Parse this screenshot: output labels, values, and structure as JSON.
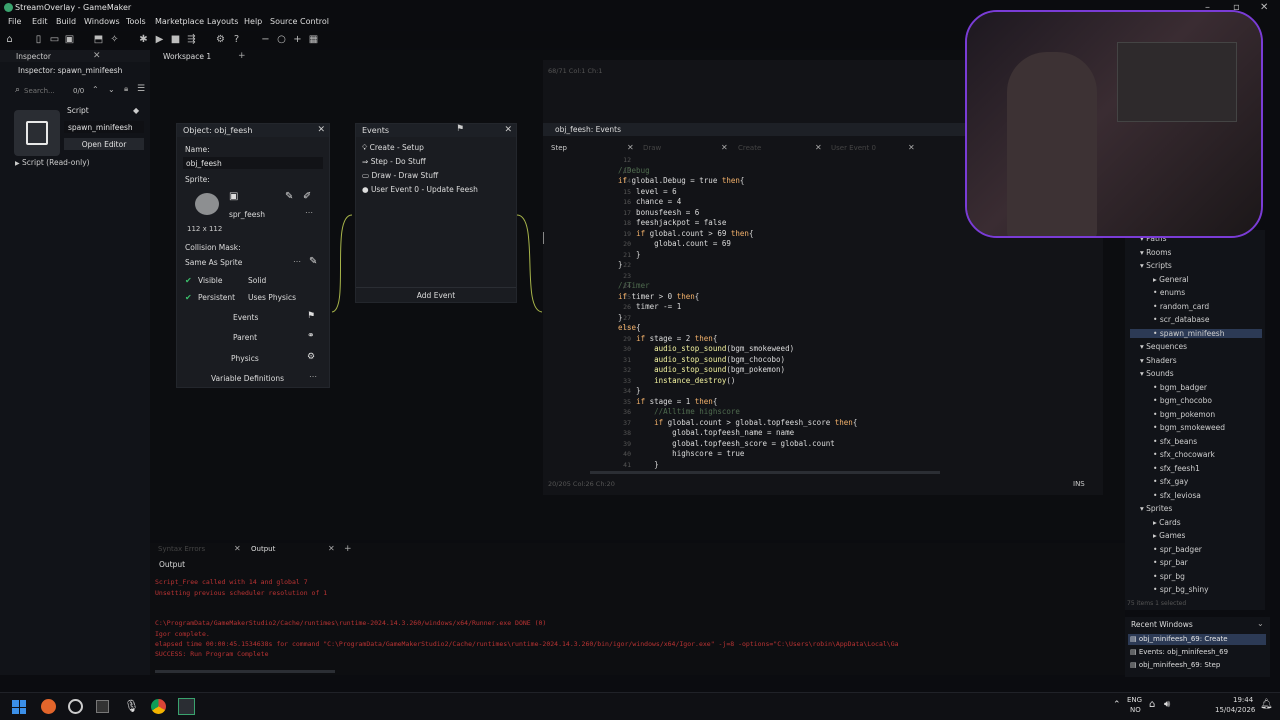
{
  "window": {
    "title": "StreamOverlay - GameMaker"
  },
  "menu": [
    "File",
    "Edit",
    "Build",
    "Windows",
    "Tools",
    "Marketplace",
    "Layouts",
    "Help",
    "Source Control"
  ],
  "inspector": {
    "tab": "Inspector",
    "subtitle": "Inspector: spawn_minifeesh",
    "search_placeholder": "Search...",
    "count": "0/0",
    "script_label": "Script",
    "script_name": "spawn_minifeesh",
    "open_editor": "Open Editor",
    "tree_item": "Script (Read-only)"
  },
  "workspace_tab": "Workspace 1",
  "object_panel": {
    "title": "Object: obj_feesh",
    "name_label": "Name:",
    "name_value": "obj_feesh",
    "sprite_label": "Sprite:",
    "sprite_name": "spr_feesh",
    "sprite_size": "112 x 112",
    "collision_label": "Collision Mask:",
    "collision_value": "Same As Sprite",
    "visible": "Visible",
    "solid": "Solid",
    "persistent": "Persistent",
    "uses_physics": "Uses Physics",
    "events_btn": "Events",
    "parent_btn": "Parent",
    "physics_btn": "Physics",
    "variable_defs": "Variable Definitions"
  },
  "events_panel": {
    "title": "Events",
    "items": [
      "Create - Setup",
      "Step - Do Stuff",
      "Draw - Draw Stuff",
      "User Event 0 - Update Feesh"
    ],
    "add_event": "Add Event"
  },
  "code_panel": {
    "title": "obj_feesh: Events",
    "tabs": [
      "Step",
      "Draw",
      "Create",
      "User Event 0"
    ],
    "top_status": "68/71 Col:1 Ch:1",
    "bottom_status": "20/205 Col:26 Ch:20",
    "mode": "INS",
    "line_numbers": [
      "12",
      "13",
      "14",
      "15",
      "16",
      "17",
      "18",
      "19",
      "20",
      "21",
      "22",
      "23",
      "24",
      "25",
      "26",
      "27",
      "28",
      "29",
      "30",
      "31",
      "32",
      "33",
      "34",
      "35",
      "36",
      "37",
      "38",
      "39",
      "40",
      "41"
    ],
    "lines": [
      "",
      "//Debug",
      "if global.Debug = true then{",
      "    level = 6",
      "    chance = 4",
      "    bonusfeesh = 6",
      "    feeshjackpot = false",
      "    if global.count > 69 then{",
      "        global.count = 69",
      "    }",
      "}",
      "",
      "//Timer",
      "if timer > 0 then{",
      "    timer -= 1",
      "}",
      "else{",
      "    if stage = 2 then{",
      "        audio_stop_sound(bgm_smokeweed)",
      "        audio_stop_sound(bgm_chocobo)",
      "        audio_stop_sound(bgm_pokemon)",
      "        instance_destroy()",
      "    }",
      "    if stage = 1 then{",
      "        //Alltime highscore",
      "        if global.count > global.topfeesh_score then{",
      "            global.topfeesh_name = name",
      "            global.topfeesh_score = global.count",
      "            highscore = true",
      "        }"
    ]
  },
  "assets": {
    "items": [
      {
        "label": "Paths",
        "indent": 1
      },
      {
        "label": "Rooms",
        "indent": 1
      },
      {
        "label": "Scripts",
        "indent": 1
      },
      {
        "label": "General",
        "indent": 2
      },
      {
        "label": "enums",
        "indent": 2
      },
      {
        "label": "random_card",
        "indent": 2
      },
      {
        "label": "scr_database",
        "indent": 2
      },
      {
        "label": "spawn_minifeesh",
        "indent": 2
      },
      {
        "label": "Sequences",
        "indent": 1
      },
      {
        "label": "Shaders",
        "indent": 1
      },
      {
        "label": "Sounds",
        "indent": 1
      },
      {
        "label": "bgm_badger",
        "indent": 2
      },
      {
        "label": "bgm_chocobo",
        "indent": 2
      },
      {
        "label": "bgm_pokemon",
        "indent": 2
      },
      {
        "label": "bgm_smokeweed",
        "indent": 2
      },
      {
        "label": "sfx_beans",
        "indent": 2
      },
      {
        "label": "sfx_chocowark",
        "indent": 2
      },
      {
        "label": "sfx_feesh1",
        "indent": 2
      },
      {
        "label": "sfx_gay",
        "indent": 2
      },
      {
        "label": "sfx_leviosa",
        "indent": 2
      },
      {
        "label": "Sprites",
        "indent": 1
      },
      {
        "label": "Cards",
        "indent": 2
      },
      {
        "label": "Games",
        "indent": 2
      },
      {
        "label": "spr_badger",
        "indent": 2
      },
      {
        "label": "spr_bar",
        "indent": 2
      },
      {
        "label": "spr_bg",
        "indent": 2
      },
      {
        "label": "spr_bg_shiny",
        "indent": 2
      }
    ],
    "footer": "75 items  1 selected"
  },
  "recent": {
    "title": "Recent Windows",
    "items": [
      "obj_minifeesh_69: Create",
      "Events: obj_minifeesh_69",
      "obj_minifeesh_69: Step"
    ]
  },
  "output": {
    "tabs": [
      "Syntax Errors",
      "Output"
    ],
    "label": "Output",
    "lines": [
      "Script_Free called with 14 and global 7",
      "Unsetting previous scheduler resolution of 1",
      "",
      "C:\\ProgramData/GameMakerStudio2/Cache/runtimes\\runtime-2024.14.3.260/windows/x64/Runner.exe DONE (0)",
      "Igor complete.",
      "elapsed time 00:00:45.1534638s for command \"C:\\ProgramData/GameMakerStudio2/Cache/runtimes\\runtime-2024.14.3.260/bin/igor/windows/x64/Igor.exe\" -j=8 -options=\"C:\\Users\\robin\\AppData\\Local\\Ga",
      "SUCCESS: Run Program Complete"
    ]
  },
  "taskbar": {
    "lang": "ENG",
    "region": "NO",
    "time": "19:44",
    "date": "15/04/2026"
  }
}
